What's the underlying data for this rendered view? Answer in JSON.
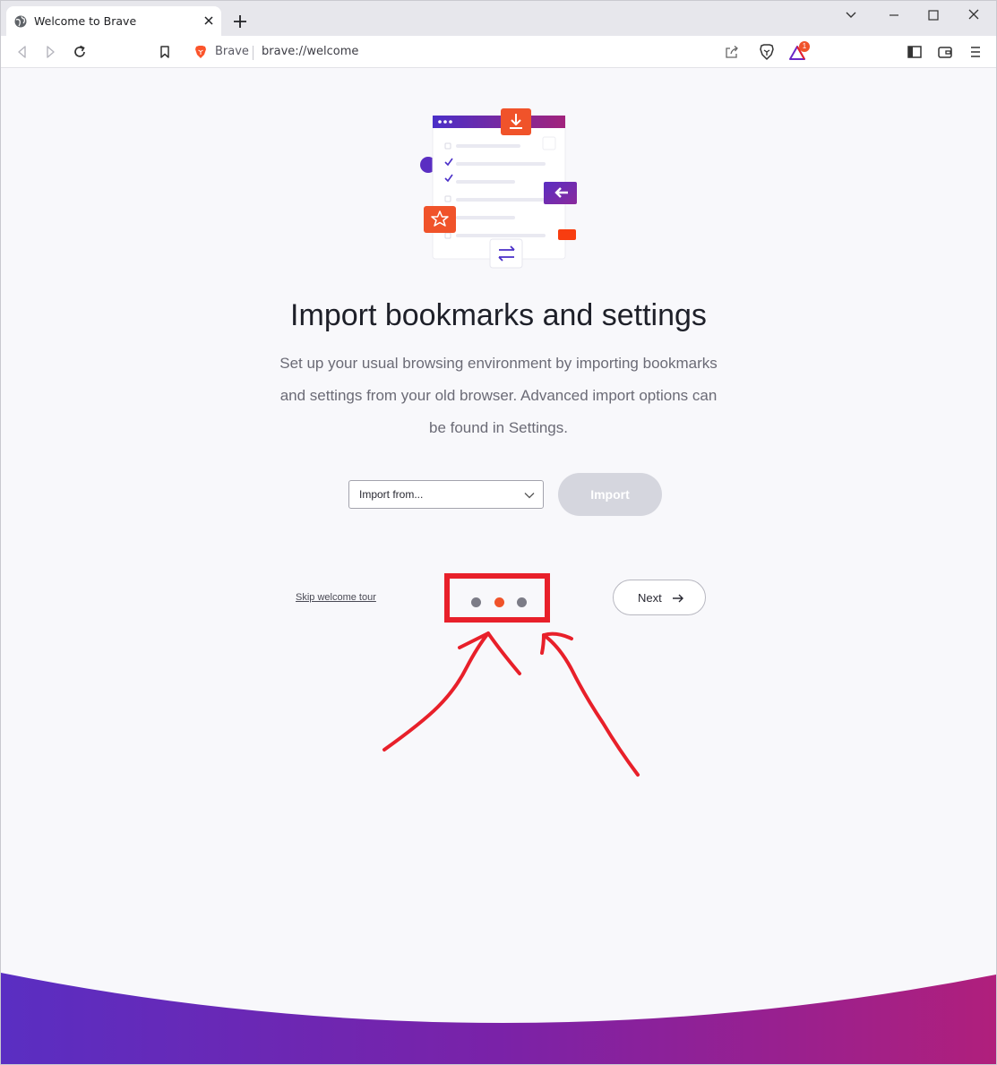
{
  "tab": {
    "title": "Welcome to Brave"
  },
  "omnibox": {
    "brand": "Brave",
    "url": "brave://welcome"
  },
  "badge": {
    "rewards_count": "1"
  },
  "page": {
    "heading": "Import bookmarks and settings",
    "description": "Set up your usual browsing environment by importing bookmarks and settings from your old browser. Advanced import options can be found in Settings.",
    "import_select": {
      "value": "Import from..."
    },
    "import_button": "Import",
    "skip_link": "Skip welcome tour",
    "next_button": "Next",
    "pagination": {
      "total": 3,
      "active_index": 1
    }
  },
  "colors": {
    "accent": "#f0532a",
    "dot_inactive": "#7c7c87",
    "annotation": "#e8202a",
    "wave_start": "#5a2ec2",
    "wave_end": "#b01f7c"
  }
}
